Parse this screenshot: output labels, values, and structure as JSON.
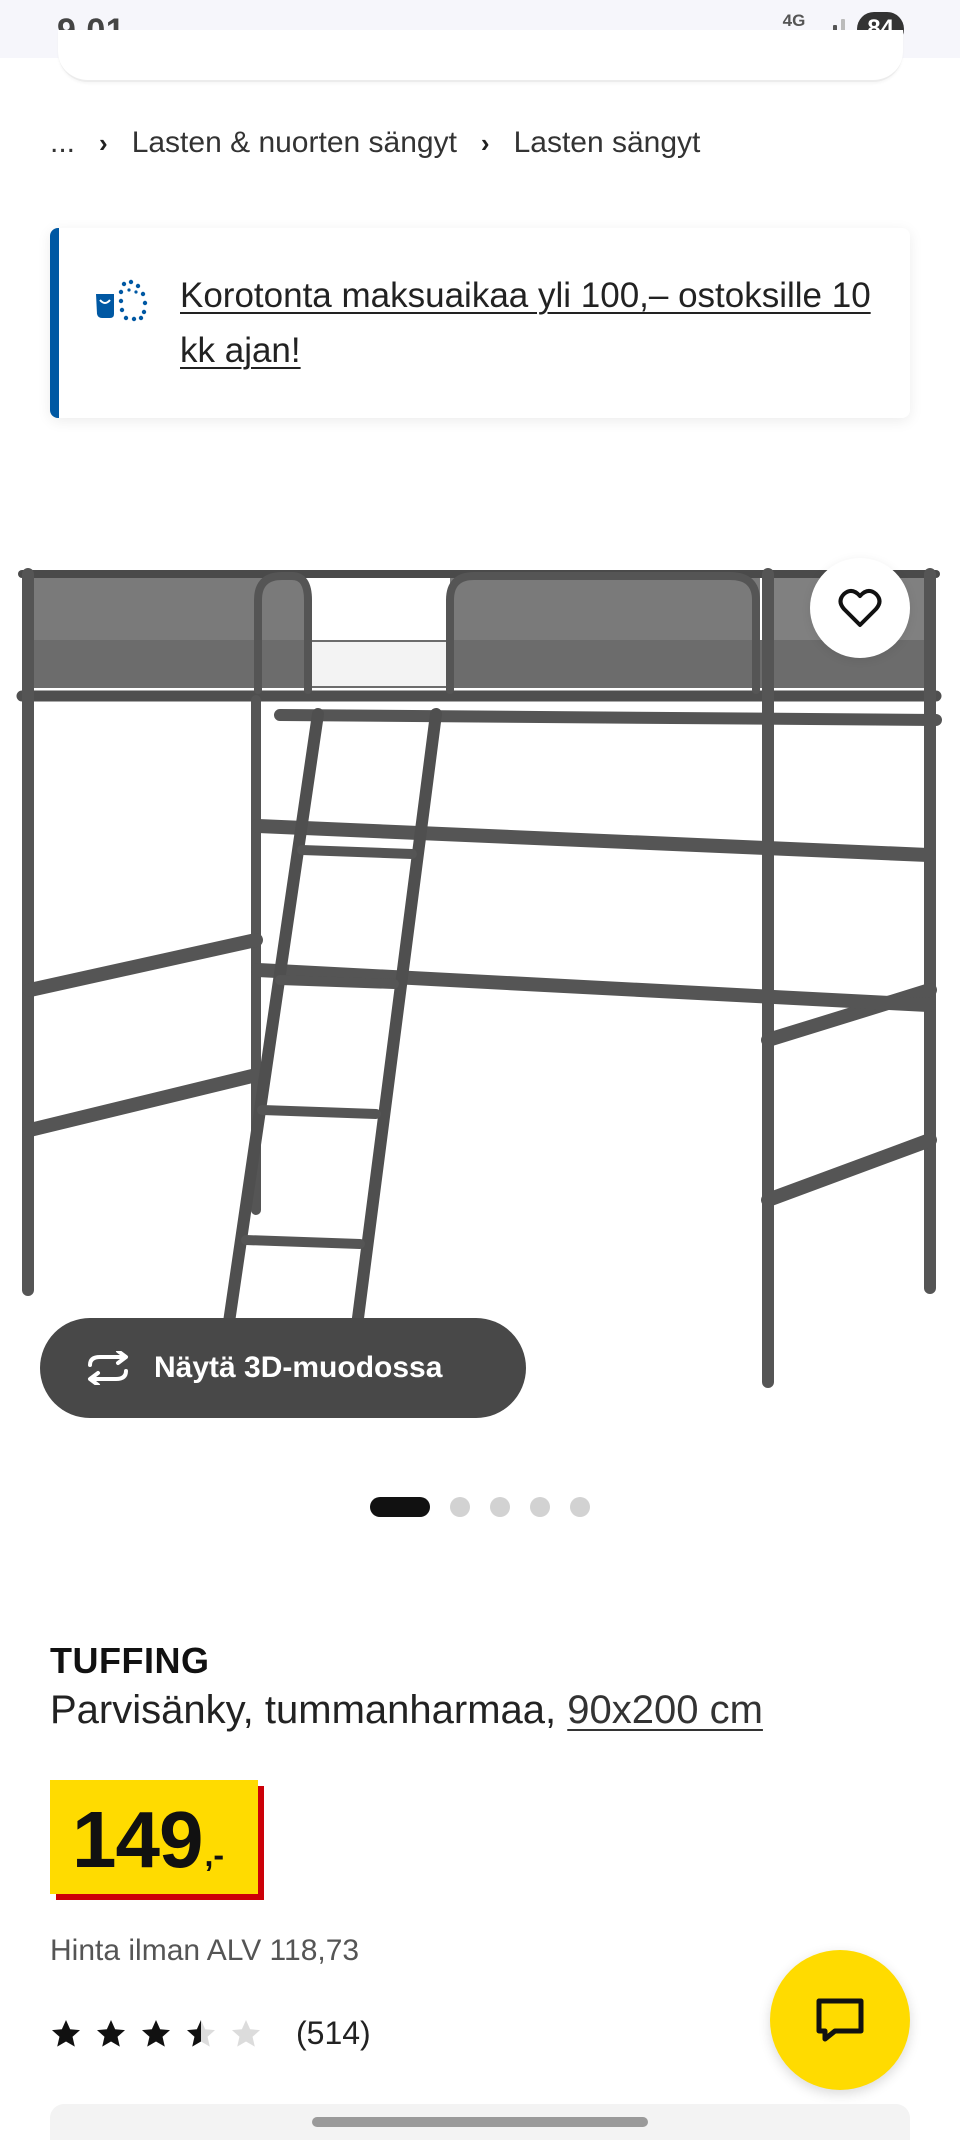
{
  "status_bar": {
    "time": "9.01",
    "network": "4G",
    "battery": "84"
  },
  "breadcrumb": {
    "ellipsis": "...",
    "items": [
      "Lasten & nuorten sängyt",
      "Lasten sängyt"
    ]
  },
  "promo": {
    "text": "Korotonta maksuaikaa yli 100,– ostoksille 10 kk ajan!",
    "accent_color": "#0058a3",
    "icon": "payment-coins-icon"
  },
  "gallery": {
    "view_3d_label": "Näytä 3D-muodossa",
    "image_count": 5,
    "active_index": 0,
    "favorite_icon": "heart-icon"
  },
  "product": {
    "brand": "TUFFING",
    "description": "Parvisänky, tummanharmaa,",
    "size": "90x200 cm",
    "price_integer": "149",
    "price_suffix": ",-",
    "price_color": "#ffdb00",
    "vat_text": "Hinta ilman ALV 118,73",
    "rating": 3.5,
    "rating_max": 5,
    "review_count": "(514)"
  },
  "chat": {
    "icon": "chat-bubble-icon",
    "color": "#ffdb00"
  }
}
